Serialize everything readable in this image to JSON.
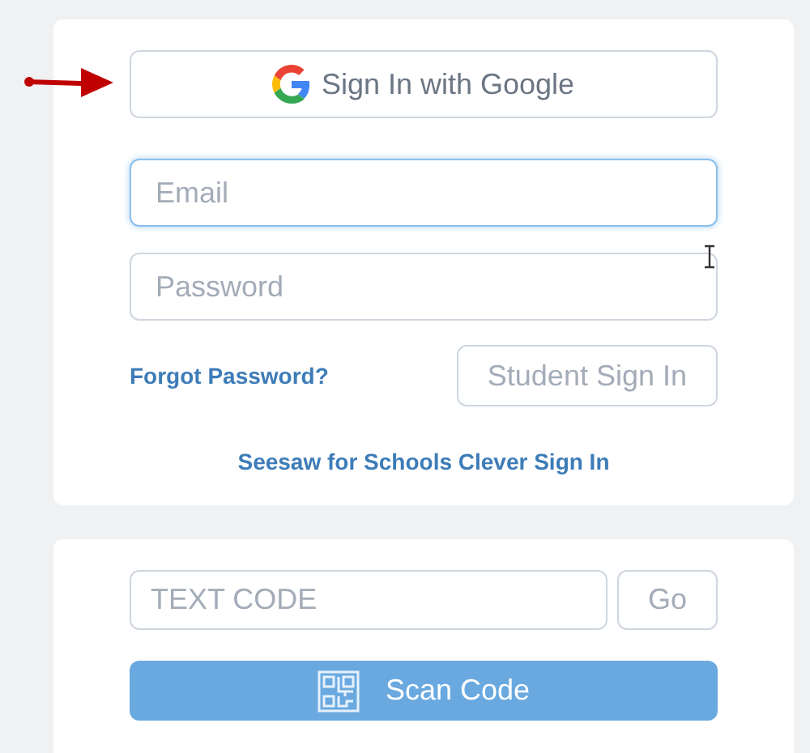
{
  "sign_in_card": {
    "google_button": {
      "label": "Sign In with Google"
    },
    "email": {
      "placeholder": "Email",
      "focused": true
    },
    "password": {
      "placeholder": "Password",
      "focused": false
    },
    "forgot_link": "Forgot Password?",
    "student_button": "Student Sign In",
    "clever_link": "Seesaw for Schools Clever Sign In"
  },
  "code_card": {
    "text_code": {
      "placeholder": "TEXT CODE"
    },
    "go_button": "Go",
    "scan_button": "Scan Code"
  }
}
